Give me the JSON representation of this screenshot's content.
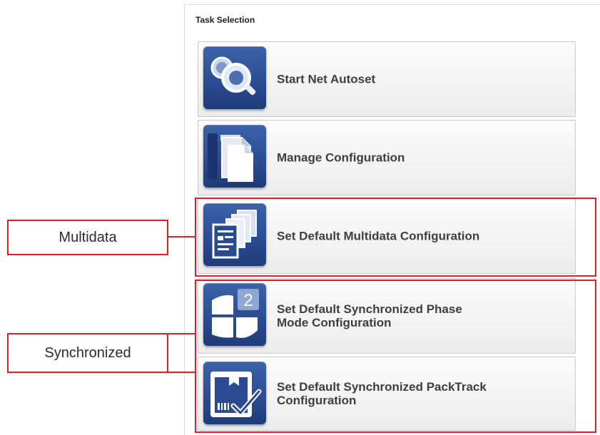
{
  "panel": {
    "title": "Task Selection"
  },
  "tasks": [
    {
      "id": "start-net-autoset",
      "label": "Start Net Autoset",
      "icon": "magnifier-icon"
    },
    {
      "id": "manage-configuration",
      "label": "Manage Configuration",
      "icon": "documents-icon"
    },
    {
      "id": "set-default-multidata",
      "label": "Set Default Multidata Configuration",
      "icon": "multidata-docs-icon"
    },
    {
      "id": "set-default-sync-phase",
      "label_line1": "Set Default Synchronized Phase",
      "label_line2": "Mode Configuration",
      "icon": "phase-mode-icon",
      "icon_badge": "2"
    },
    {
      "id": "set-default-sync-packtrack",
      "label_line1": "Set Default Synchronized PackTrack",
      "label_line2": "Configuration",
      "icon": "packtrack-check-icon"
    }
  ],
  "callouts": [
    {
      "label": "Multidata"
    },
    {
      "label": "Synchronized"
    }
  ],
  "colors": {
    "icon_blue": "#2a4b91",
    "callout_red": "#dd1f26",
    "label_gray": "#3e3e3e"
  }
}
